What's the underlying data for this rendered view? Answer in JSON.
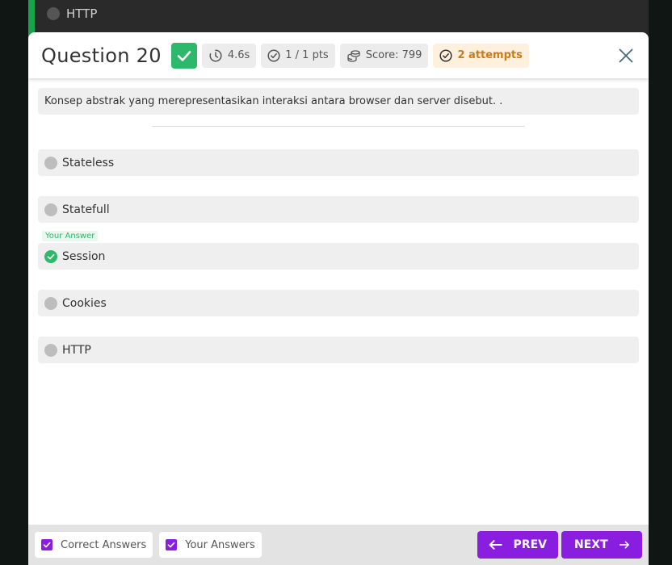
{
  "background": {
    "option_label": "HTTP"
  },
  "modal": {
    "title": "Question 20",
    "time": "4.6s",
    "points": "1 / 1 pts",
    "score": "Score: 799",
    "attempts": "2 attempts",
    "question_text": "Konsep abstrak yang merepresentasikan interaksi antara browser dan server disebut. .",
    "your_answer_tag": "Your Answer",
    "options": [
      {
        "label": "Stateless",
        "selected": false
      },
      {
        "label": "Statefull",
        "selected": false
      },
      {
        "label": "Session",
        "selected": true
      },
      {
        "label": "Cookies",
        "selected": false
      },
      {
        "label": "HTTP",
        "selected": false
      }
    ]
  },
  "footer": {
    "correct_answers_label": "Correct Answers",
    "your_answers_label": "Your Answers",
    "prev_label": "PREV",
    "next_label": "NEXT"
  },
  "colors": {
    "correct_green": "#2eb86b",
    "accent_purple": "#8a1ee0",
    "attempts_orange": "#c97a1a"
  },
  "icons": {
    "status": "check-icon",
    "time": "timer-icon",
    "points": "check-circle-icon",
    "score": "coins-icon",
    "attempts": "check-circle-icon",
    "close": "close-icon",
    "prev": "arrow-left-icon",
    "next": "arrow-right-icon"
  }
}
